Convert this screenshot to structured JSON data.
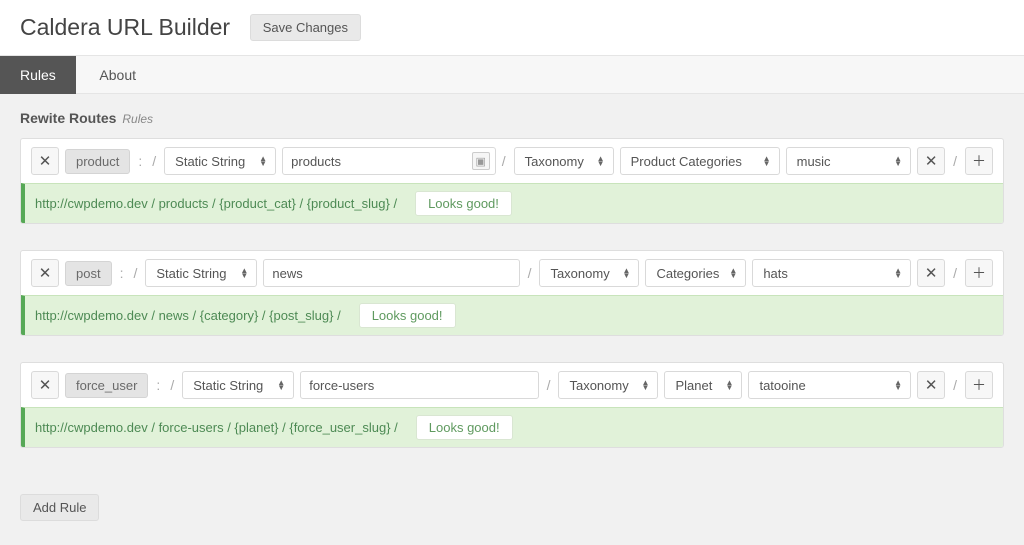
{
  "header": {
    "title": "Caldera URL Builder",
    "save_label": "Save Changes"
  },
  "tabs": {
    "rules": "Rules",
    "about": "About"
  },
  "section": {
    "title": "Rewite Routes",
    "subtitle": "Rules"
  },
  "rules": [
    {
      "tag": "product",
      "type_select": "Static String",
      "slug": "products",
      "show_slug_icon": true,
      "tax_select": "Taxonomy",
      "tax_name": "Product Categories",
      "term": "music",
      "preview": "http://cwpdemo.dev / products / {product_cat} / {product_slug} /",
      "status": "Looks good!"
    },
    {
      "tag": "post",
      "type_select": "Static String",
      "slug": "news",
      "show_slug_icon": false,
      "tax_select": "Taxonomy",
      "tax_name": "Categories",
      "term": "hats",
      "preview": "http://cwpdemo.dev / news / {category} / {post_slug} /",
      "status": "Looks good!"
    },
    {
      "tag": "force_user",
      "type_select": "Static String",
      "slug": "force-users",
      "show_slug_icon": false,
      "tax_select": "Taxonomy",
      "tax_name": "Planet",
      "term": "tatooine",
      "preview": "http://cwpdemo.dev / force-users / {planet} / {force_user_slug} /",
      "status": "Looks good!"
    }
  ],
  "buttons": {
    "add_rule": "Add Rule"
  }
}
